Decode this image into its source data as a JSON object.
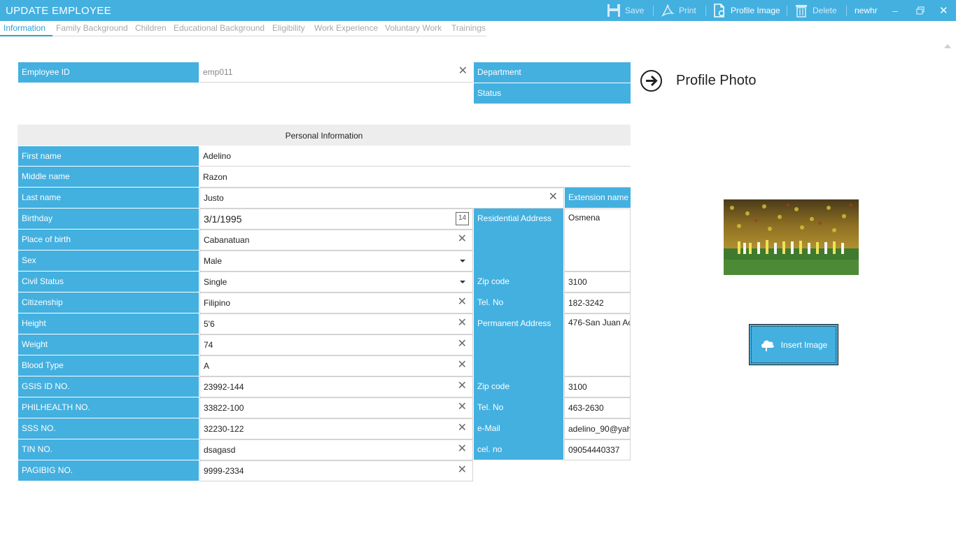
{
  "window": {
    "title": "UPDATE EMPLOYEE",
    "user": "newhr"
  },
  "toolbar": {
    "save_label": "Save",
    "print_label": "Print",
    "profile_image_label": "Profile Image",
    "delete_label": "Delete"
  },
  "tabs": [
    {
      "label": "Information"
    },
    {
      "label": "Family Background"
    },
    {
      "label": "Children"
    },
    {
      "label": "Educational Background"
    },
    {
      "label": "Eligibility"
    },
    {
      "label": "Work Experience"
    },
    {
      "label": "Voluntary Work"
    },
    {
      "label": "Trainings"
    }
  ],
  "header_fields": {
    "employee_id_label": "Employee ID",
    "employee_id_value": "emp011",
    "department_label": "Department",
    "status_label": "Status"
  },
  "section_title": "Personal Information",
  "personal": {
    "first_name_label": "First name",
    "first_name": "Adelino",
    "middle_name_label": "Middle name",
    "middle_name": "Razon",
    "last_name_label": "Last name",
    "last_name": "Justo",
    "extension_label": "Extension name",
    "birthday_label": "Birthday",
    "birthday": "3/1/1995",
    "calendar_day": "14",
    "place_of_birth_label": "Place of birth",
    "place_of_birth": "Cabanatuan",
    "sex_label": "Sex",
    "sex": "Male",
    "civil_status_label": "Civil Status",
    "civil_status": "Single",
    "citizenship_label": "Citizenship",
    "citizenship": "Filipino",
    "height_label": "Height",
    "height": "5'6",
    "weight_label": "Weight",
    "weight": "74",
    "blood_type_label": "Blood Type",
    "blood_type": "A",
    "gsis_label": "GSIS ID NO.",
    "gsis": "23992-144",
    "philhealth_label": "PHILHEALTH NO.",
    "philhealth": "33822-100",
    "sss_label": "SSS NO.",
    "sss": "32230-122",
    "tin_label": "TIN NO.",
    "tin": "dsagasd",
    "pagibig_label": "PAGIBIG NO.",
    "pagibig": "9999-2334"
  },
  "contact": {
    "res_address_label": "Residential Address",
    "res_address": "Osmena",
    "res_zip_label": "Zip code",
    "res_zip": "3100",
    "res_tel_label": "Tel. No",
    "res_tel": "182-3242",
    "perm_address_label": "Permanent Address",
    "perm_address": "476-San Juan Ac",
    "perm_zip_label": "Zip code",
    "perm_zip": "3100",
    "perm_tel_label": "Tel. No",
    "perm_tel": "463-2630",
    "email_label": "e-Mail",
    "email": "adelino_90@yah",
    "cel_label": "cel. no",
    "cel": "09054440337"
  },
  "profile": {
    "title": "Profile Photo",
    "insert_label": "Insert Image"
  },
  "colors": {
    "accent": "#43b0e0",
    "tab_active": "#2a9fd6"
  },
  "icons": {
    "save": "save-icon",
    "print": "print-icon",
    "profile_image": "profile-image-icon",
    "delete": "delete-icon",
    "minimize": "minimize-icon",
    "restore": "restore-icon",
    "close": "close-icon",
    "arrow": "arrow-right-circle-icon",
    "cloud": "cloud-icon"
  }
}
